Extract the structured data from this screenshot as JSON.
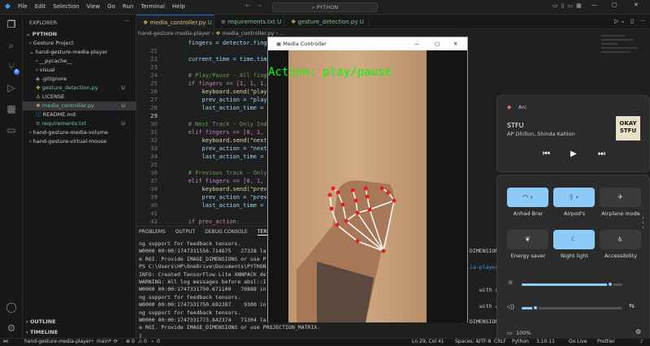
{
  "menu": [
    "File",
    "Edit",
    "Selection",
    "View",
    "Go",
    "Run",
    "Terminal",
    "Help"
  ],
  "search_text": "PYTHON",
  "explorer": {
    "title": "EXPLORER",
    "root": "PYTHON",
    "items": [
      {
        "label": "Gesture Project",
        "status": ""
      },
      {
        "label": "hand-gesture-media-player",
        "status": ""
      },
      {
        "label": "__pycache__",
        "status": ""
      },
      {
        "label": "visual",
        "status": ""
      },
      {
        "label": ".gitignore",
        "status": ""
      },
      {
        "label": "gesture_detection.py",
        "status": "U"
      },
      {
        "label": "LICENSE",
        "status": ""
      },
      {
        "label": "media_controller.py",
        "status": "U"
      },
      {
        "label": "README.md",
        "status": ""
      },
      {
        "label": "requirements.txt",
        "status": "U"
      },
      {
        "label": "hand-gesture-media-volume",
        "status": ""
      },
      {
        "label": "hand-gesture-virtual-mouse",
        "status": ""
      }
    ],
    "outline": "OUTLINE",
    "timeline": "TIMELINE"
  },
  "tabs": [
    {
      "label": "media_controller.py",
      "status": "U"
    },
    {
      "label": "requirements.txt",
      "status": "U"
    },
    {
      "label": "gesture_detection.py",
      "status": "U"
    }
  ],
  "breadcrumb": [
    "hand-gesture-media-player",
    "media_controller.py"
  ],
  "code_lines": [
    {
      "n": "",
      "t": "        fingers = detector.finge"
    },
    {
      "n": "21",
      "t": ""
    },
    {
      "n": "22",
      "t": "        current_time = time.tim"
    },
    {
      "n": "23",
      "t": ""
    },
    {
      "n": "24",
      "t": "        # Play/Pause - All finge"
    },
    {
      "n": "25",
      "t": "        if fingers == [1, 1, 1,"
    },
    {
      "n": "26",
      "t": "            keyboard.send(\"play/"
    },
    {
      "n": "27",
      "t": "            prev_action = \"play/"
    },
    {
      "n": "28",
      "t": "            last_action_time = c"
    },
    {
      "n": "29",
      "t": ""
    },
    {
      "n": "30",
      "t": "        # Next Track - Only Inde"
    },
    {
      "n": "31",
      "t": "        elif fingers == [0, 1, 0"
    },
    {
      "n": "32",
      "t": "            keyboard.send(\"next"
    },
    {
      "n": "33",
      "t": "            prev_action = \"next"
    },
    {
      "n": "34",
      "t": "            last_action_time = c"
    },
    {
      "n": "35",
      "t": ""
    },
    {
      "n": "36",
      "t": "        # Previous Track - Only"
    },
    {
      "n": "37",
      "t": "        elif fingers == [0, 1, 1"
    },
    {
      "n": "38",
      "t": "            keyboard.send(\"previ"
    },
    {
      "n": "39",
      "t": "            prev_action = \"previ"
    },
    {
      "n": "40",
      "t": "            last_action_time = c"
    },
    {
      "n": "41",
      "t": ""
    },
    {
      "n": "42",
      "t": "        if prev_action:"
    }
  ],
  "panel_tabs": [
    "PROBLEMS",
    "OUTPUT",
    "DEBUG CONSOLE",
    "TERMI"
  ],
  "terminal_lines": [
    "ng support for feedback tensors.",
    "W0000 00:00:1747331556.714875   27328 la",
    "e ROI. Provide IMAGE_DIMENSIONS or use P",
    "PS C:\\Users\\HP\\OneDrive\\Documents\\PYTHON",
    "INFO: Created TensorFlow Lite XNNPACK del",
    "WARNING: All log messages before absl::I",
    "W0000 00:00:1747331750.671100   70888 in",
    "ng support for feedback tensors.",
    "W0000 00:00:1747331750.692387    9300 in",
    "ng support for feedback tensors.",
    "W0000 00:00:1747331773.842374   71304 la",
    "e ROI. Provide IMAGE_DIMENSIONS or use PROJECTION_MATRIX."
  ],
  "terminal_right": [
    "DIMENSIONS",
    "ia-player\\",
    "with a si",
    "with a si",
    "DIMENSIONS"
  ],
  "media_window": {
    "title": "Media Controller",
    "action_text": "Action: play/pause",
    "action_color": "#00ff00"
  },
  "status": {
    "branch": "main*",
    "errors": "0",
    "warnings": "0",
    "ports": "0",
    "workspace": "hand-gesture-media-player",
    "position": "Ln 29, Col 41",
    "spaces": "Spaces: 4",
    "encoding": "UTF-8",
    "eol": "CRLF",
    "lang": "Python",
    "version": "3.10.11",
    "golive": "Go Live",
    "prettier": "Prettier"
  },
  "quick_settings": {
    "media_app": "Arc",
    "track_title": "STFU",
    "track_artist": "AP Dhillon, Shinda Kahlon",
    "album_art_text": "OKAY STFU",
    "tiles": [
      {
        "label": "Anhad Brar",
        "icon": "wifi-icon",
        "on": true
      },
      {
        "label": "Airpod's",
        "icon": "bluetooth-icon",
        "on": true
      },
      {
        "label": "Airplane mode",
        "icon": "airplane-icon",
        "on": false
      },
      {
        "label": "Energy saver",
        "icon": "leaf-icon",
        "on": false
      },
      {
        "label": "Night light",
        "icon": "night-light-icon",
        "on": true
      },
      {
        "label": "Accessibility",
        "icon": "accessibility-icon",
        "on": false
      }
    ],
    "brightness": 0.88,
    "volume": 0.14,
    "battery": "100%",
    "accent": "#8ccaf7"
  }
}
